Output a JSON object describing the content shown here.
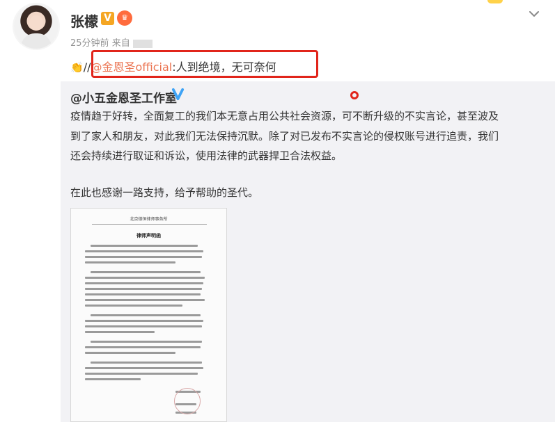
{
  "post": {
    "username": "张檬",
    "v_badge": "V",
    "meta_time": "25分钟前",
    "meta_source": "来自",
    "repost_slash": "//",
    "repost_mention": "@金恩圣official",
    "repost_text": ":人到绝境，无可奈何"
  },
  "original": {
    "author": "@小五金恩圣工作室",
    "lines": [
      "疫情趋于好转，全面复工的我们本无意占用公共社会资源，可不断升级的不实言论，甚至波及",
      "到了家人和朋友，对此我们无法保持沉默。除了对已发布不实言论的侵权账号进行追责，我们",
      "还会持续进行取证和诉讼，使用法律的武器捍卫合法权益。",
      "在此也感谢一路支持，给予帮助的圣代。"
    ]
  },
  "document": {
    "header": "北京德恒律师事务所",
    "title": "律师声明函"
  },
  "icons": {
    "chevron": "chevron-down-icon",
    "clap": "clap-emoji-icon",
    "verified": "blue-verified-icon"
  },
  "colors": {
    "mention": "#eb7350",
    "highlight": "#e1251b",
    "card_bg": "#f2f2f5"
  }
}
